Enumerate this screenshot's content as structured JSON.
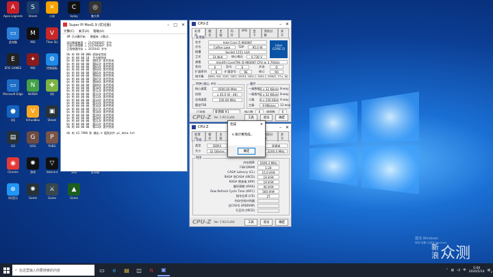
{
  "desktop_icons": [
    {
      "label": "Apex\nLegends",
      "color": "#c8202a",
      "glyph": "A"
    },
    {
      "label": "Steam",
      "color": "#1b3d6b",
      "glyph": "S"
    },
    {
      "label": "小米",
      "color": "#f4a200",
      "glyph": "✕"
    },
    {
      "label": "Uplay",
      "color": "#111",
      "glyph": "C"
    },
    {
      "label": "鲁大师",
      "color": "#333",
      "glyph": "◎"
    },
    {
      "label": "此电脑",
      "color": "#2a7fd8",
      "glyph": "▭"
    },
    {
      "label": "MSI",
      "color": "#111",
      "glyph": "M"
    },
    {
      "label": "Titan\nSLI",
      "color": "#c62828",
      "glyph": "V"
    },
    {
      "label": "回收站",
      "color": "#3a8ee6",
      "glyph": "🗑"
    },
    {
      "label": "Afterburner",
      "color": "#222",
      "glyph": "A"
    },
    {
      "label": "EPIC\nGAMES",
      "color": "#222",
      "glyph": "E"
    },
    {
      "label": "MSI",
      "color": "#8b1a1a",
      "glyph": "✦"
    },
    {
      "label": "控制面板",
      "color": "#1e88e5",
      "glyph": "⚙"
    },
    {
      "label": "CE",
      "color": "#333",
      "glyph": "◧"
    },
    {
      "label": "IE",
      "color": "#1565c0",
      "glyph": "e"
    },
    {
      "label": "Microsoft\nEdge",
      "color": "#1e6ec8",
      "glyph": "▭"
    },
    {
      "label": "NVIDIA",
      "color": "#43a047",
      "glyph": "N"
    },
    {
      "label": "QQ",
      "color": "#7cb342",
      "glyph": "✚"
    },
    {
      "label": "Wallpaper",
      "color": "#444",
      "glyph": "▣"
    },
    {
      "label": "Origin",
      "color": "#e65100",
      "glyph": "O"
    },
    {
      "label": "QQ",
      "color": "#1565c0",
      "glyph": "●"
    },
    {
      "label": "VirtualBox",
      "color": "#f9a825",
      "glyph": "V"
    },
    {
      "label": "Steam",
      "color": "#263238",
      "glyph": "▣"
    },
    {
      "label": "360",
      "color": "#26a69a",
      "glyph": "⌘"
    },
    {
      "label": "网易云",
      "color": "#1565c0",
      "glyph": "⊕"
    },
    {
      "label": "GO",
      "color": "#263238",
      "glyph": "▤"
    },
    {
      "label": "GOG",
      "color": "#6d4c41",
      "glyph": "G"
    },
    {
      "label": "PUBG",
      "color": "#795548",
      "glyph": "P"
    },
    {
      "label": "文件夹",
      "color": "#f9a825",
      "glyph": "▤"
    },
    {
      "label": "杀软",
      "color": "#2e7d32",
      "glyph": "V"
    },
    {
      "label": "Chrome",
      "color": "#e53935",
      "glyph": "◉"
    },
    {
      "label": "游戏",
      "color": "#111",
      "glyph": "✺"
    },
    {
      "label": "Valorant",
      "color": "#111",
      "glyph": "▽"
    },
    {
      "label": "游戏",
      "color": "#c62828",
      "glyph": "◈"
    },
    {
      "label": "此电脑",
      "color": "#1976d2",
      "glyph": "▣"
    },
    {
      "label": "QQ音乐",
      "color": "#2196f3",
      "glyph": "⊕"
    },
    {
      "label": "Game",
      "color": "#263238",
      "glyph": "✺"
    },
    {
      "label": "Game",
      "color": "#37474f",
      "glyph": "⚔"
    },
    {
      "label": "Game",
      "color": "#1b5e20",
      "glyph": "▲"
    }
  ],
  "superpi": {
    "title": "Super PI Mod1.9 (优化版)",
    "menu": [
      "计算(C)",
      "关于(A)",
      "帮助(H)"
    ],
    "log": " 4M 已计算开始 - 数据有 小数点.\n\n 实际数据使用 = 2147483647 字节\n 已执行进程数 = 2147483647 字节\n 已用物理内存 = 3355443 字节\n\n Ok 的 00 00 000 初始化完成\n 0s 的 00 00 10  平方根完成\n 0s 的 00 00 00  第01次 迭代完成\n 0s 的 00 00 00  第02次 迭代完成\n 0s 的 00 00 00  第03次 迭代完成\n 0s 的 00 00 00  第04次 迭代完成\n 0s 的 00 00 00  第05次 迭代完成\n 0s 的 00 00 00  第06次 迭代完成\n 0s 的 00 00 00  第07次 迭代完成\n 0s 的 00 00 00  第08次 迭代完成\n 0s 的 00 00 00  第09次 迭代完成\n 0s 的 00 00 00  第10次 迭代完成\n 0s 的 00 00 00  第11次 迭代完成\n 0s 的 00 00 00  第12次 迭代完成\n 0s 的 00 00 00  第13次 迭代完成\n 0s 的 00 00 00  第14次 迭代完成\n 0s 的 00 00 00  第15次 迭代完成\n 0s 的 00 00 00  第16次 迭代完成\n 0s 的 00 00 00  第17次 迭代完成\n 0s 的 00 00 00  第18次 迭代完成\n 0s 的 00 00 00  第19次 迭代完成\n 0s 的 00 00 00  第20次 迭代完成\n 0s 的 00 00 00  第21次 迭代完成\n 0s 的 00 00 00  第22次 迭代完成\n Ok 的 00 00 00  第23次 迭代完成\n\n Ok 的 43.7990 秒 输出 π 值到文件 pi_data.txt"
  },
  "cpuz_cpu": {
    "title": "CPU-Z",
    "tabs": [
      "处理器",
      "缓存",
      "主板",
      "内存",
      "SPD",
      "显卡",
      "测试分数",
      "关于"
    ],
    "group_processor": "处理器",
    "labels": {
      "name": "名字",
      "codename": "代号",
      "package": "插槽",
      "tech": "工艺",
      "spec": "规格",
      "family": "系列",
      "extfamily": "扩展系列",
      "instr": "指令集"
    },
    "name": "Intel Core i5 9600KF",
    "codename": "Coffee Lake",
    "tdp_label": "TDP",
    "tdp": "95.0 W",
    "package": "Socket 1151 LGA",
    "tech": "14 纳米",
    "vcore_label": "核心电压",
    "vcore": "0.736 V",
    "spec": "Intel(R) Core(TM) i5-9600KF CPU @ 3.70GHz",
    "family": "6",
    "model_label": "型号",
    "model": "E",
    "stepping_label": "步进",
    "stepping": "D",
    "extfamily": "6",
    "extmodel_label": "扩展型号",
    "extmodel": "9E",
    "revision_label": "修订",
    "revision": "R0",
    "instr": "MMX, SSE, SSE2, SSE3, SSSE3, SSE4.1, SSE4.2, EM64T, VT-x, AES, AVX, AVX2, FMA3",
    "group_clocks": "时钟 (核心 #0)",
    "clock_labels": {
      "core": "核心速度",
      "mult": "倍频",
      "bus": "总线速度",
      "fsb": "额定FSB"
    },
    "core_speed": "4500.00 MHz",
    "mult": "x 45.0 (8 - 46)",
    "bus": "100.00 MHz",
    "group_cache": "缓存",
    "cache_rows": [
      {
        "label": "一级数据",
        "value": "6 x 32 KBytes",
        "way": "8-way"
      },
      {
        "label": "一级指令",
        "value": "6 x 32 KBytes",
        "way": "8-way"
      },
      {
        "label": "二级",
        "value": "6 x 256 KBytes",
        "way": "4-way"
      },
      {
        "label": "三级",
        "value": "9 MBytes",
        "way": "12-way"
      }
    ],
    "selected_label": "已选择",
    "selected": "处理器 #1",
    "cores_label": "核心数",
    "cores": "6",
    "threads_label": "线程数",
    "threads": "6",
    "footer_logo": "CPU-Z",
    "version": "Ver. 1.92.0.x64",
    "btn_tools": "工具",
    "btn_validate": "验证",
    "btn_ok": "确定"
  },
  "cpuz_mem": {
    "title": "CPU-Z",
    "tabs": [
      "处理器",
      "缓存",
      "主板",
      "内存",
      "SPD",
      "显卡",
      "测试分数",
      "关于"
    ],
    "group_general": "常规",
    "type_label": "类型",
    "type": "DDR4",
    "size_label": "大小",
    "size": "32 GBytes",
    "right_vals": [
      "双通道",
      "3200.0 MHz"
    ],
    "group_timing": "时序",
    "timings": [
      {
        "label": "内存频率",
        "value": "1600.3 MHz"
      },
      {
        "label": "FSB:DRAM",
        "value": "1:24"
      },
      {
        "label": "CAS# Latency (CL)",
        "value": "15.0 时钟"
      },
      {
        "label": "RAS# 到CAS# (tRCD)",
        "value": "19 时钟"
      },
      {
        "label": "RAS# 预充电 (tRP)",
        "value": "19 时钟"
      },
      {
        "label": "循环周期 (tRAS)",
        "value": "40 时钟"
      },
      {
        "label": "Row Refresh Cycle Time (tRFC)",
        "value": "560 时钟"
      },
      {
        "label": "指令比率 (CR)",
        "value": "2T"
      },
      {
        "label": "内存空闲计时器",
        "value": ""
      },
      {
        "label": "总CAS号 (tRDRAM)",
        "value": ""
      },
      {
        "label": "行至列 (tRCD)",
        "value": ""
      }
    ],
    "footer_logo": "CPU-Z",
    "version": "Ver. 1.92.0.x64",
    "btn_tools": "工具",
    "btn_validate": "验证",
    "btn_ok": "确定"
  },
  "dialog": {
    "title": "完成",
    "message": "π 值计算完成。",
    "ok": "确定"
  },
  "taskbar": {
    "search_placeholder": "在这里输入你要搜索的内容",
    "time": "5:00",
    "date": "2020/5/14",
    "lang": "中",
    "notification_count": "2"
  },
  "watermark": {
    "activate": "激活 Windows",
    "activate_sub": "转到\"设置\"以激活 Windows。",
    "brand_line1": "新",
    "brand_line2": "浪",
    "brand_line3": "众测"
  }
}
